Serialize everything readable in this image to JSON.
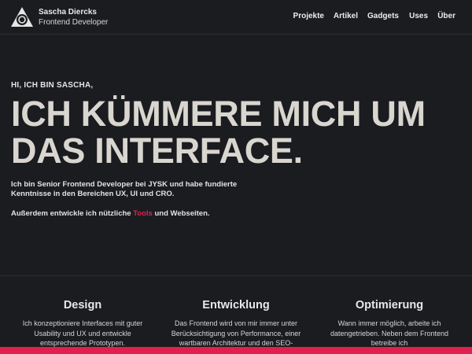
{
  "header": {
    "name": "Sascha Diercks",
    "role": "Frontend Developer",
    "nav": [
      "Projekte",
      "Artikel",
      "Gadgets",
      "Uses",
      "Über"
    ]
  },
  "hero": {
    "kicker": "HI, ICH BIN SASCHA,",
    "title_line1": "ICH KÜMMERE MICH UM",
    "title_line2": "DAS INTERFACE.",
    "intro": "Ich bin Senior Frontend Developer bei JYSK und habe fundierte Kenntnisse in den Bereichen UX, UI und CRO.",
    "intro2_before": "Außerdem entwickle ich nützliche ",
    "intro2_link": "Tools",
    "intro2_after": " und Webseiten."
  },
  "services": [
    {
      "title": "Design",
      "text": "Ich konzeptioniere Interfaces mit guter Usability und UX und entwickle entsprechende Prototypen."
    },
    {
      "title": "Entwicklung",
      "text": "Das Frontend wird von mir immer unter Berücksichtigung von Performance, einer wartbaren Architektur und den SEO-"
    },
    {
      "title": "Optimierung",
      "text": "Wann immer möglich, arbeite ich datengetrieben. Neben dem Frontend betreibe ich"
    }
  ],
  "colors": {
    "background": "#1b1c20",
    "accent": "#e0204f",
    "title": "#d9d6d0"
  },
  "icons": {
    "logo": "triangle-circle-logo-icon"
  }
}
